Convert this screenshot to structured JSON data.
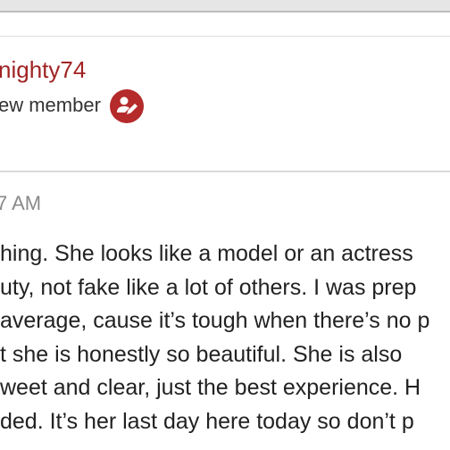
{
  "user": {
    "username": "nighty74",
    "role": "ew member",
    "badge_icon": "pencil-icon"
  },
  "post": {
    "timestamp": "7 AM",
    "lines": [
      "hing. She looks like a model or an actress",
      "uty, not fake like a lot of others. I was prep",
      "average, cause it’s tough when there’s no p",
      "t she is honestly so beautiful. She is also",
      "weet and clear, just the best experience. H",
      "ded. It’s her last day here today so don’t p"
    ]
  },
  "colors": {
    "username": "#a02323",
    "badge": "#b52a2a",
    "timestamp": "#8a8a8a",
    "text": "#222222"
  }
}
